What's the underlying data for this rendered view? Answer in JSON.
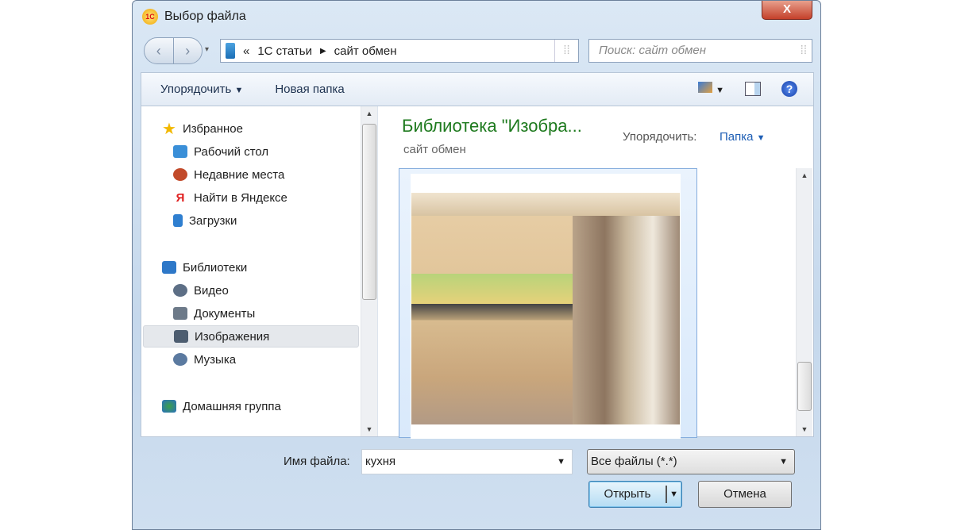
{
  "window": {
    "title": "Выбор файла",
    "logo": "1С",
    "close": "X"
  },
  "nav": {
    "path_prefix": "«",
    "path": [
      "1С статьи",
      "сайт обмен"
    ],
    "search_placeholder": "Поиск: сайт обмен"
  },
  "toolbar": {
    "organize": "Упорядочить",
    "new_folder": "Новая папка"
  },
  "sidebar": {
    "favorites": {
      "label": "Избранное",
      "items": [
        {
          "label": "Рабочий стол",
          "color": "#3a8fd8"
        },
        {
          "label": "Недавние места",
          "color": "#c24a2a"
        },
        {
          "label": "Найти в Яндексе",
          "color": "#e02020"
        },
        {
          "label": "Загрузки",
          "color": "#2f7fd0"
        }
      ]
    },
    "libraries": {
      "label": "Библиотеки",
      "items": [
        {
          "label": "Видео"
        },
        {
          "label": "Документы"
        },
        {
          "label": "Изображения"
        },
        {
          "label": "Музыка"
        }
      ]
    },
    "homegroup": "Домашняя группа"
  },
  "main": {
    "title": "Библиотека \"Изобра...",
    "subtitle": "сайт обмен",
    "arrange_label": "Упорядочить:",
    "arrange_value": "Папка"
  },
  "footer": {
    "filename_label": "Имя файла:",
    "filename": "кухня",
    "filetype": "Все файлы (*.*)",
    "open": "Открыть",
    "cancel": "Отмена"
  }
}
